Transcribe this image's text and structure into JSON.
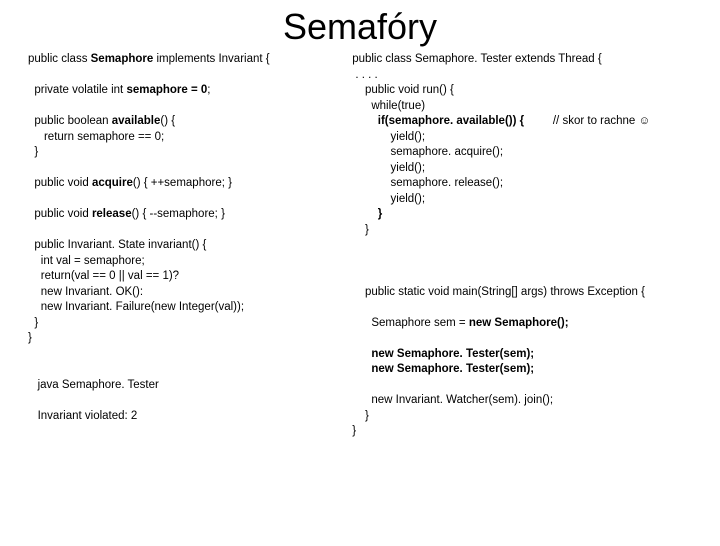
{
  "title": "Semafóry",
  "left": {
    "l1a": "public class ",
    "l1b": "Semaphore",
    "l1c": " implements Invariant {",
    "l2a": "  private volatile int ",
    "l2b": "semaphore = 0",
    "l2c": ";",
    "l3a": "  public boolean ",
    "l3b": "available",
    "l3c": "() {",
    "l4": "     return semaphore == 0;",
    "l5": "  }",
    "l6a": "  public void ",
    "l6b": "acquire",
    "l6c": "() { ++semaphore; }",
    "l7a": "  public void ",
    "l7b": "release",
    "l7c": "() { --semaphore; }",
    "l8": "  public Invariant. State invariant() {",
    "l9": "    int val = semaphore;",
    "l10": "    return(val == 0 || val == 1)?",
    "l11": "    new Invariant. OK():",
    "l12": "    new Invariant. Failure(new Integer(val));",
    "l13": "  }",
    "l14": "}",
    "out1": "java Semaphore. Tester",
    "out2": "Invariant violated: 2"
  },
  "right": {
    "r1": "public class Semaphore. Tester extends Thread {",
    "r2": " . . . .",
    "r3": "    public void run() {",
    "r4": "      while(true)",
    "r5a": "        if(semaphore. available()) {",
    "r5b": "         // skor to rachne ☺",
    "r6": "            yield();",
    "r7": "            semaphore. acquire();",
    "r8": "            yield();",
    "r9": "            semaphore. release();",
    "r10": "            yield();",
    "r11": "        }",
    "r12": "    }",
    "m1": "    public static void main(String[] args) throws Exception {",
    "m2a": "      Semaphore sem = ",
    "m2b": "new Semaphore();",
    "m3a": "      ",
    "m3b": "new Semaphore. Tester(sem);",
    "m4a": "      ",
    "m4b": "new Semaphore. Tester(sem);",
    "m5": "      new Invariant. Watcher(sem). join();",
    "m6": "    }",
    "m7": "}"
  }
}
